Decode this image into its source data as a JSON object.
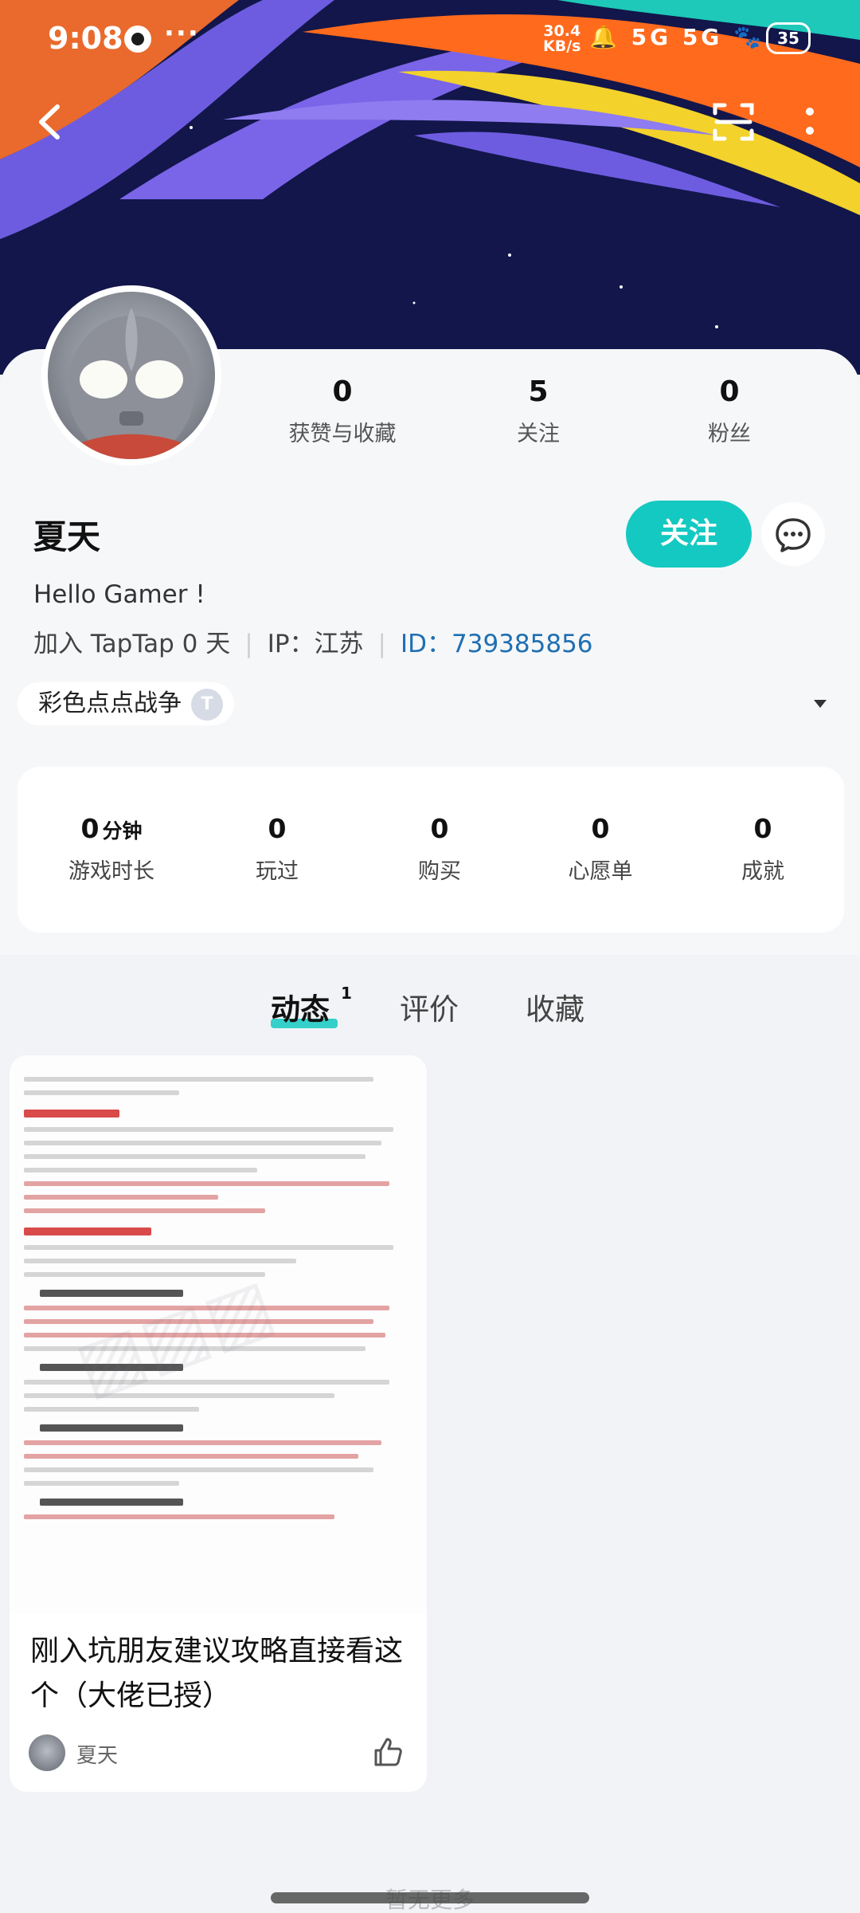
{
  "status_bar": {
    "time": "9:08",
    "dots": "···",
    "speed_value": "30.4",
    "speed_unit": "KB/s",
    "network_icons": "🔔 5G 5G 🐾",
    "battery": "35"
  },
  "icons": {
    "back": "back-arrow-icon",
    "scan": "scan-icon",
    "more": "more-vertical-icon",
    "message": "chat-bubble-icon",
    "like": "thumbs-up-icon",
    "dropdown": "caret-down-icon"
  },
  "profile": {
    "name": "夏天",
    "bio": "Hello Gamer !",
    "joined": "加入 TapTap 0 天",
    "ip": "IP：江苏",
    "id": "ID：739385856",
    "follow_label": "关注"
  },
  "stats": [
    {
      "value": "0",
      "label": "获赞与收藏"
    },
    {
      "value": "5",
      "label": "关注"
    },
    {
      "value": "0",
      "label": "粉丝"
    }
  ],
  "game_chip": {
    "name": "彩色点点战争",
    "badge": "T"
  },
  "game_stats": [
    {
      "value": "0",
      "unit": "分钟",
      "label": "游戏时长"
    },
    {
      "value": "0",
      "unit": "",
      "label": "玩过"
    },
    {
      "value": "0",
      "unit": "",
      "label": "购买"
    },
    {
      "value": "0",
      "unit": "",
      "label": "心愿单"
    },
    {
      "value": "0",
      "unit": "",
      "label": "成就"
    }
  ],
  "tabs": [
    {
      "label": "动态",
      "count": "1",
      "active": true
    },
    {
      "label": "评价",
      "active": false
    },
    {
      "label": "收藏",
      "active": false
    }
  ],
  "post": {
    "title": "刚入坑朋友建议攻略直接看这个（大佬已授）",
    "author": "夏天"
  },
  "footer": {
    "no_more": "暂无更多"
  },
  "colors": {
    "accent": "#14c9c1",
    "id_link": "#1f6fb2",
    "banner_bg": "#101440"
  }
}
